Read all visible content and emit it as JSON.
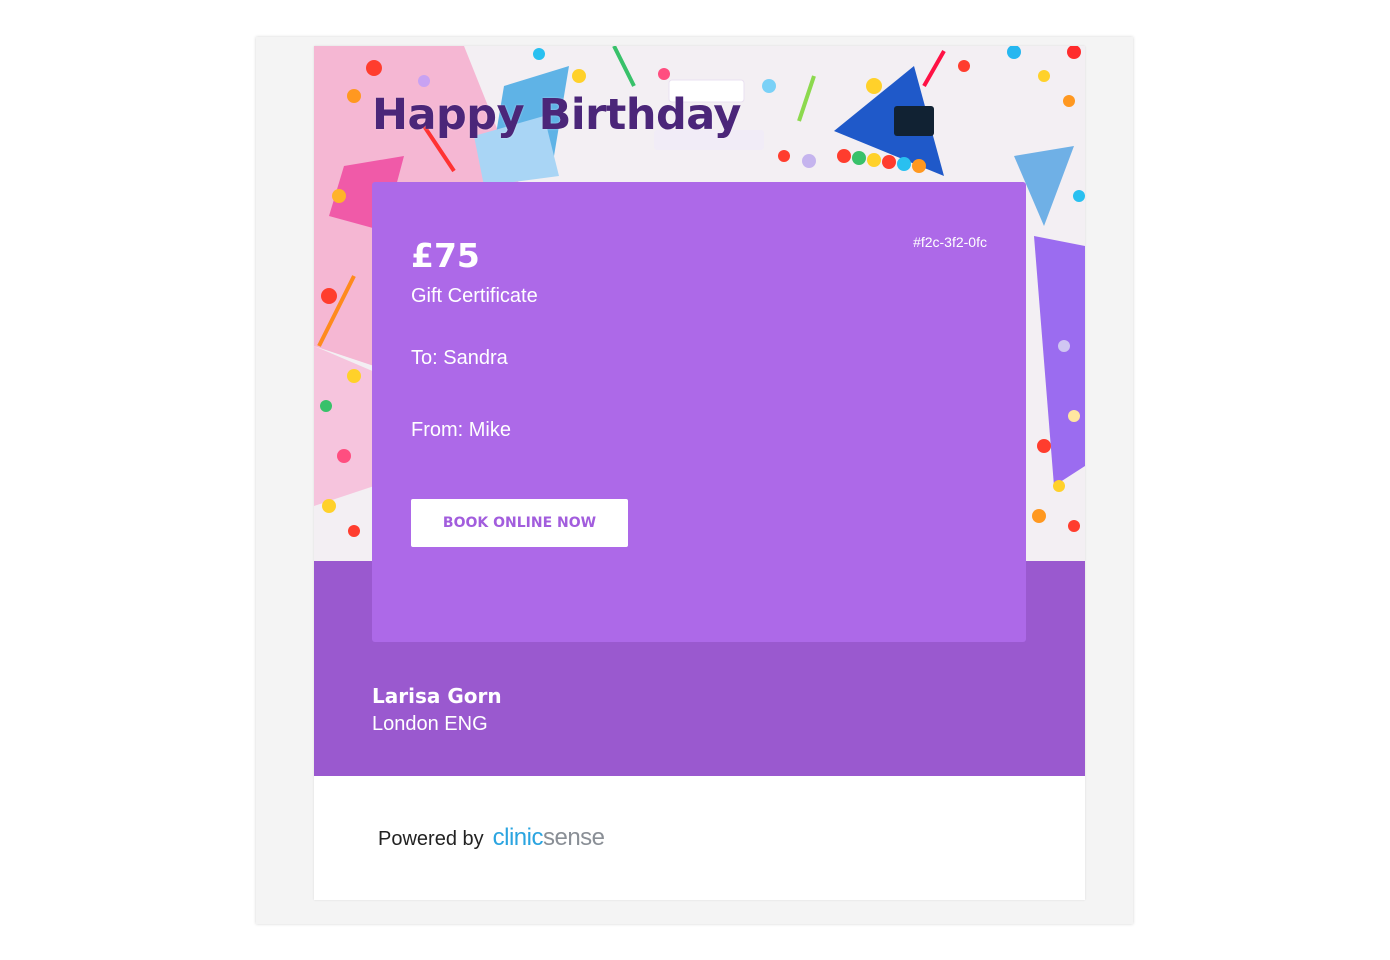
{
  "email": {
    "hero_title": "Happy Birthday",
    "card": {
      "amount": "£75",
      "label": "Gift Certificate",
      "code": "#f2c-3f2-0fc",
      "to_line": "To: Sandra",
      "from_line": "From: Mike",
      "cta_label": "BOOK ONLINE NOW"
    },
    "clinic": {
      "name": "Larisa Gorn",
      "location": "London ENG"
    },
    "footer": {
      "powered_by": "Powered by",
      "brand_part1": "clinic",
      "brand_part2": "sense"
    }
  },
  "colors": {
    "card": "#ad69e8",
    "band": "#9a59cf",
    "title": "#4b2679",
    "cta_text": "#a25ddd",
    "brand_blue": "#2aa4e0",
    "brand_grey": "#8a8f96"
  }
}
